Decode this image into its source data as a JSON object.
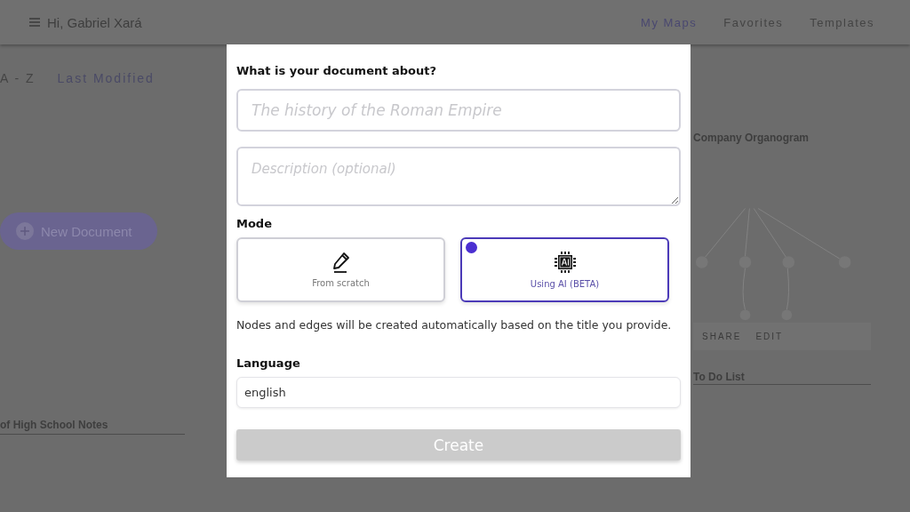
{
  "header": {
    "greeting": "Hi, Gabriel Xará",
    "nav": [
      {
        "label": "My Maps",
        "selected": true
      },
      {
        "label": "Favorites",
        "selected": false
      },
      {
        "label": "Templates",
        "selected": false
      }
    ]
  },
  "sort": [
    {
      "label": "A - Z",
      "selected": false
    },
    {
      "label": "Last Modified",
      "selected": true
    }
  ],
  "new_document": "New Document",
  "cards_left": [
    {
      "title": "of High School Notes"
    }
  ],
  "cards_right": [
    {
      "title": "Company Organogram",
      "actions": [
        "SHARE",
        "EDIT"
      ]
    },
    {
      "title": "To Do List"
    }
  ],
  "dialog": {
    "title_label": "What is your document about?",
    "title_field": {
      "placeholder": "The history of the Roman Empire"
    },
    "description_field": {
      "placeholder": "Description (optional)"
    },
    "mode_label": "Mode",
    "modes": [
      {
        "label": "From scratch",
        "kind": "pencil",
        "selected": false
      },
      {
        "label": "Using AI (BETA)",
        "kind": "ai",
        "selected": true
      }
    ],
    "hint": "Nodes and edges will be created automatically based on the title you provide.",
    "language_label": "Language",
    "language": {
      "value": "english"
    },
    "create": {
      "label": "Create",
      "disabled": true
    }
  }
}
